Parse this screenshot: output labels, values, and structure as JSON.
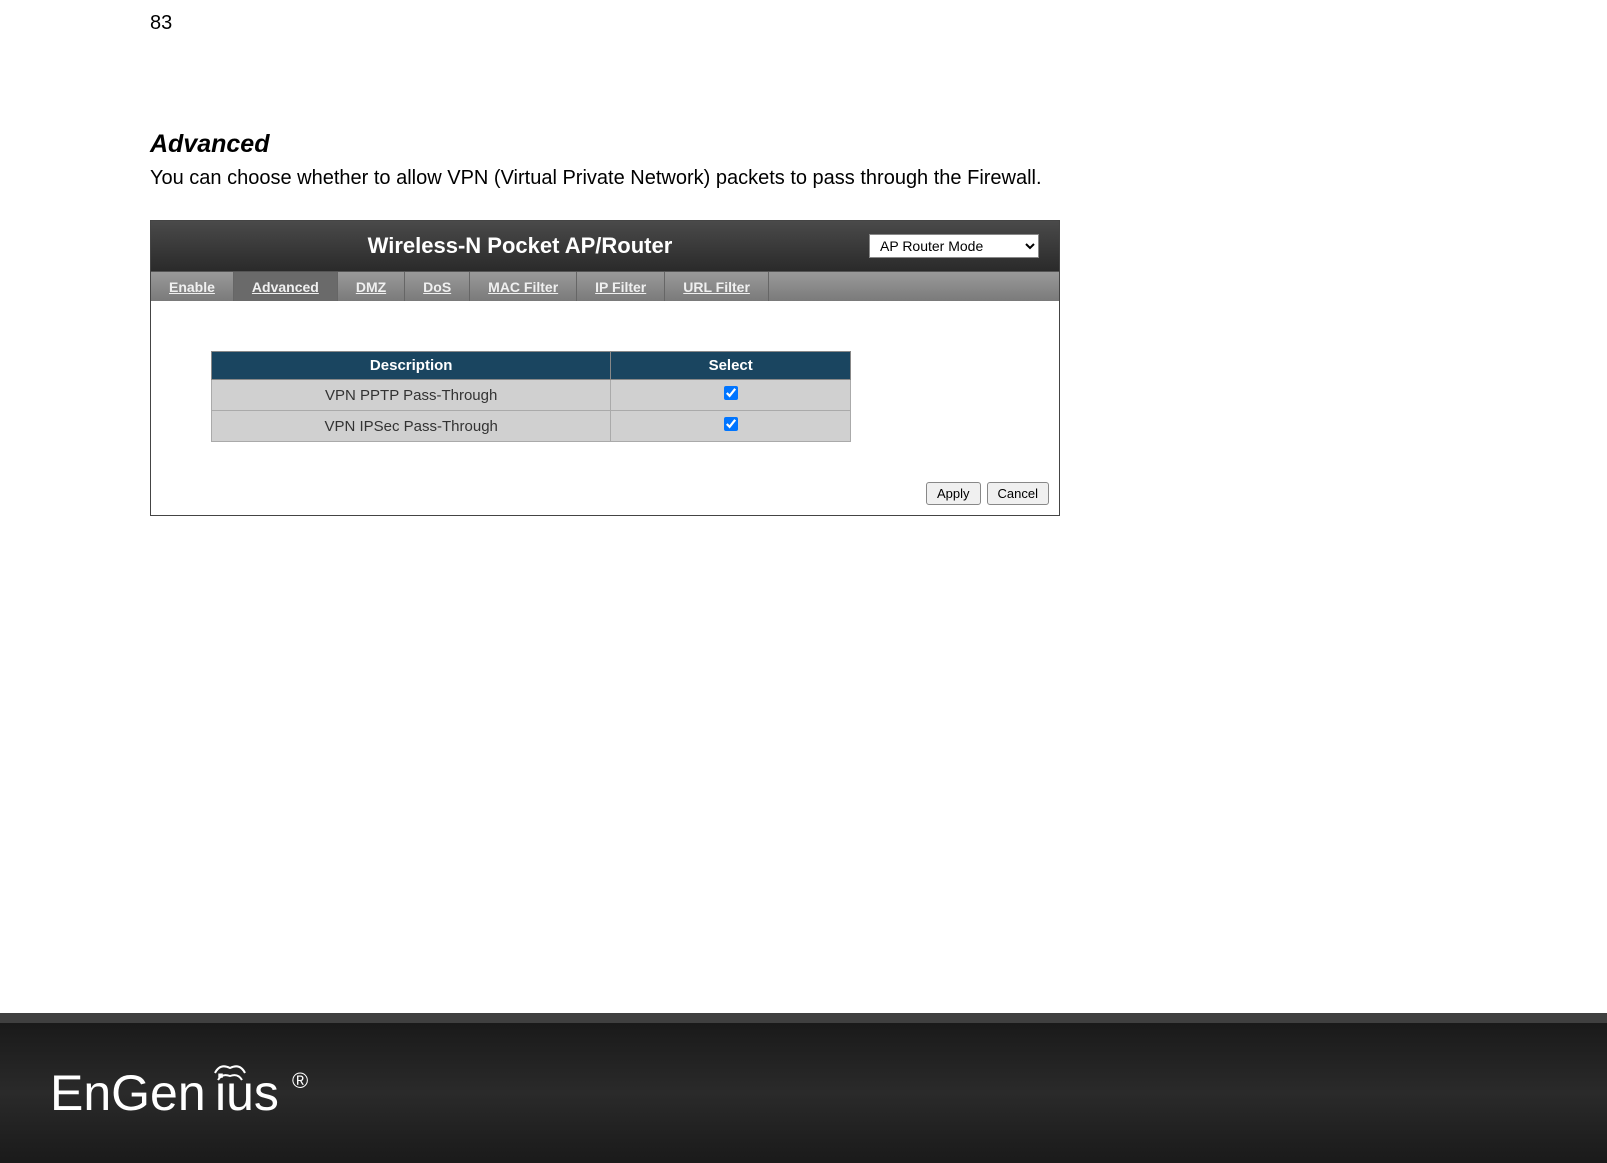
{
  "page_number": "83",
  "section": {
    "heading": "Advanced",
    "description": "You can choose whether to allow VPN (Virtual Private Network) packets to pass through the Firewall."
  },
  "router_ui": {
    "title": "Wireless-N Pocket AP/Router",
    "mode": "AP Router Mode",
    "tabs": [
      {
        "label": "Enable",
        "active": false
      },
      {
        "label": "Advanced",
        "active": true
      },
      {
        "label": "DMZ",
        "active": false
      },
      {
        "label": "DoS",
        "active": false
      },
      {
        "label": "MAC Filter",
        "active": false
      },
      {
        "label": "IP Filter",
        "active": false
      },
      {
        "label": "URL Filter",
        "active": false
      }
    ],
    "table": {
      "headers": {
        "description": "Description",
        "select": "Select"
      },
      "rows": [
        {
          "description": "VPN PPTP Pass-Through",
          "checked": true
        },
        {
          "description": "VPN IPSec Pass-Through",
          "checked": true
        }
      ]
    },
    "buttons": {
      "apply": "Apply",
      "cancel": "Cancel"
    }
  },
  "footer": {
    "logo_text": "EnGenius",
    "logo_symbol": "®"
  }
}
